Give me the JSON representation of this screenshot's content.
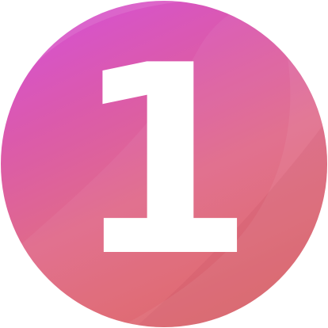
{
  "badge": {
    "numeral": "1",
    "colors": {
      "top_left": "#d44fdc",
      "middle": "#e06a8a",
      "bottom_right": "#d95a5c",
      "numeral": "#ffffff"
    }
  }
}
